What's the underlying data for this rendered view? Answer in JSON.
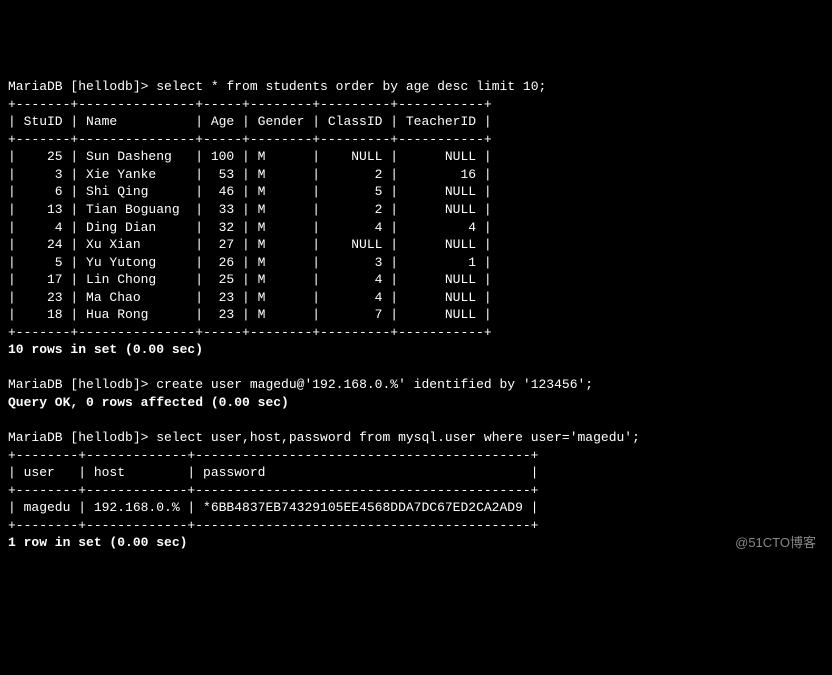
{
  "prompt": "MariaDB [hellodb]> ",
  "q1": "select * from students order by age desc limit 10;",
  "q2": "create user magedu@'192.168.0.%' identified by '123456';",
  "q3": "select user,host,password from mysql.user where user='magedu';",
  "t1": {
    "sep": "+-------+---------------+-----+--------+---------+-----------+",
    "hdr": "| StuID | Name          | Age | Gender | ClassID | TeacherID |",
    "rows": [
      "|    25 | Sun Dasheng   | 100 | M      |    NULL |      NULL |",
      "|     3 | Xie Yanke     |  53 | M      |       2 |        16 |",
      "|     6 | Shi Qing      |  46 | M      |       5 |      NULL |",
      "|    13 | Tian Boguang  |  33 | M      |       2 |      NULL |",
      "|     4 | Ding Dian     |  32 | M      |       4 |         4 |",
      "|    24 | Xu Xian       |  27 | M      |    NULL |      NULL |",
      "|     5 | Yu Yutong     |  26 | M      |       3 |         1 |",
      "|    17 | Lin Chong     |  25 | M      |       4 |      NULL |",
      "|    23 | Ma Chao       |  23 | M      |       4 |      NULL |",
      "|    18 | Hua Rong      |  23 | M      |       7 |      NULL |"
    ],
    "footer": "10 rows in set (0.00 sec)"
  },
  "r2": "Query OK, 0 rows affected (0.00 sec)",
  "t2": {
    "sep": "+--------+-------------+-------------------------------------------+",
    "hdr": "| user   | host        | password                                  |",
    "row": "| magedu | 192.168.0.% | *6BB4837EB74329105EE4568DDA7DC67ED2CA2AD9 |",
    "footer": "1 row in set (0.00 sec)"
  },
  "chart_data": {
    "type": "table",
    "tables": [
      {
        "title": "students order by age desc limit 10",
        "columns": [
          "StuID",
          "Name",
          "Age",
          "Gender",
          "ClassID",
          "TeacherID"
        ],
        "rows": [
          [
            25,
            "Sun Dasheng",
            100,
            "M",
            null,
            null
          ],
          [
            3,
            "Xie Yanke",
            53,
            "M",
            2,
            16
          ],
          [
            6,
            "Shi Qing",
            46,
            "M",
            5,
            null
          ],
          [
            13,
            "Tian Boguang",
            33,
            "M",
            2,
            null
          ],
          [
            4,
            "Ding Dian",
            32,
            "M",
            4,
            4
          ],
          [
            24,
            "Xu Xian",
            27,
            "M",
            null,
            null
          ],
          [
            5,
            "Yu Yutong",
            26,
            "M",
            3,
            1
          ],
          [
            17,
            "Lin Chong",
            25,
            "M",
            4,
            null
          ],
          [
            23,
            "Ma Chao",
            23,
            "M",
            4,
            null
          ],
          [
            18,
            "Hua Rong",
            23,
            "M",
            7,
            null
          ]
        ]
      },
      {
        "title": "mysql.user where user='magedu'",
        "columns": [
          "user",
          "host",
          "password"
        ],
        "rows": [
          [
            "magedu",
            "192.168.0.%",
            "*6BB4837EB74329105EE4568DDA7DC67ED2CA2AD9"
          ]
        ]
      }
    ]
  },
  "watermark": "@51CTO博客"
}
